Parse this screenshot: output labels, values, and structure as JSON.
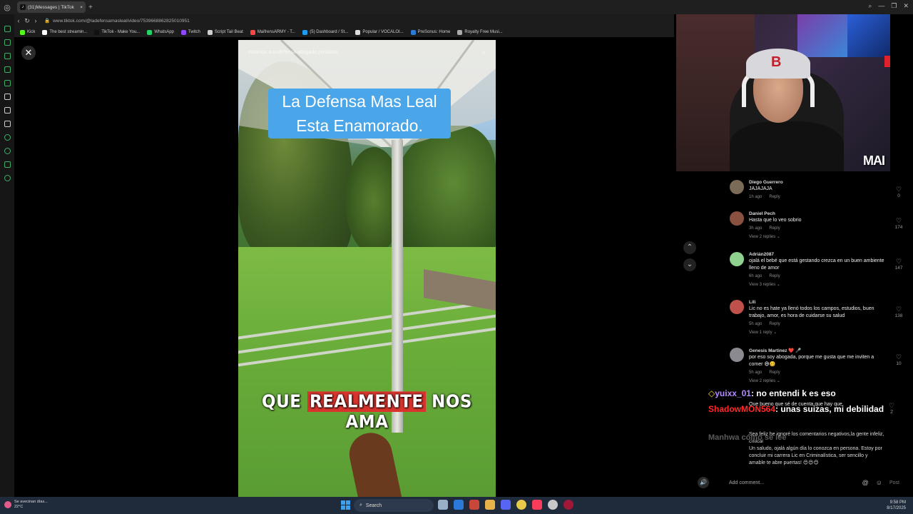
{
  "browser": {
    "tab_title": "(31)Messages | TikTok",
    "tab_new": "+",
    "url": "www.tiktok.com/@ladefensamasleal/video/7539668862825010951",
    "bookmarks": [
      "Kick",
      "The best streamin...",
      "TikTok - Make You...",
      "WhatsApp",
      "Twitch",
      "Script Tail Beat",
      "MaifrensARMY - T...",
      "(5) Dashboard / St...",
      "Popular / VOCALOI...",
      "PreSonus: Home",
      "Royalty Free Musi..."
    ]
  },
  "video": {
    "top_text": "estamos a tu defensa abogado penalista",
    "caption_line1": "La Defensa Mas Leal",
    "caption_line2": "Esta Enamorado.",
    "subtitle_pre": "QUE ",
    "subtitle_highlight": "REALMENTE",
    "subtitle_post": " NOS AMA"
  },
  "webcam": {
    "tag": "MAI"
  },
  "comments": [
    {
      "name": "Diego Guerrero",
      "text": "JAJAJAJA",
      "time": "1h ago",
      "reply": "Reply",
      "likes": "0",
      "replies": "",
      "avatar": "#7a6a58"
    },
    {
      "name": "Daniel Pech",
      "text": "Hasta que lo veo sobrio",
      "time": "3h ago",
      "reply": "Reply",
      "likes": "174",
      "replies": "View 2 replies",
      "avatar": "#8a5040"
    },
    {
      "name": "Adrián2087",
      "text": "ojalá el bebé que está gestando crezca en un buen ambiente lleno de amor",
      "time": "6h ago",
      "reply": "Reply",
      "likes": "147",
      "replies": "View 3 replies",
      "avatar": "#8fd18f"
    },
    {
      "name": "Lili",
      "text": "Lic no es hate ya llenó todos los campos, estudios, buen trabajo, amor, es hora de cuidarse su salud",
      "time": "5h ago",
      "reply": "Reply",
      "likes": "138",
      "replies": "View 1 reply",
      "avatar": "#c0504a"
    },
    {
      "name": "Genesis Martinez ❤️ 🎤",
      "text": "por eso soy abogada, porque me gusta que me inviten a comer 😅🥴",
      "time": "5h ago",
      "reply": "Reply",
      "likes": "10",
      "replies": "View 2 replies",
      "avatar": "#8a8a90"
    }
  ],
  "overlay_comment": {
    "text": "Que bueno que sé de cuenta que hay que",
    "likes": "2",
    "line2": "Sea feliz he ignoré los comentarios negativos,la gente infeliz, critical",
    "line3": "Un saludo, ojalá algún día lo conozca en persona. Estoy por concluir mi carrera Lic en Criminalística, ser sencillo y amable te abre puertas! 😍😍😊"
  },
  "chat": {
    "user1": "yuixx_01",
    "msg1": ": no entendi k es eso",
    "user2": "ShadowMON564",
    "msg2": ": unas suizas, mi debilidad",
    "faded_user": "Manhwa",
    "faded_msg": "cómo se lee"
  },
  "comment_bar": {
    "placeholder": "Add comment...",
    "post": "Post"
  },
  "taskbar": {
    "weather_line1": "Se avecinan días...",
    "weather_line2": "22°C",
    "search": "Search",
    "time": "9:58 PM",
    "date": "8/17/2025"
  },
  "colors": {
    "caption_bg": "#4aa6e8",
    "subtitle_highlight": "#d8342d",
    "sidebar_accent": "#3fae6a"
  }
}
